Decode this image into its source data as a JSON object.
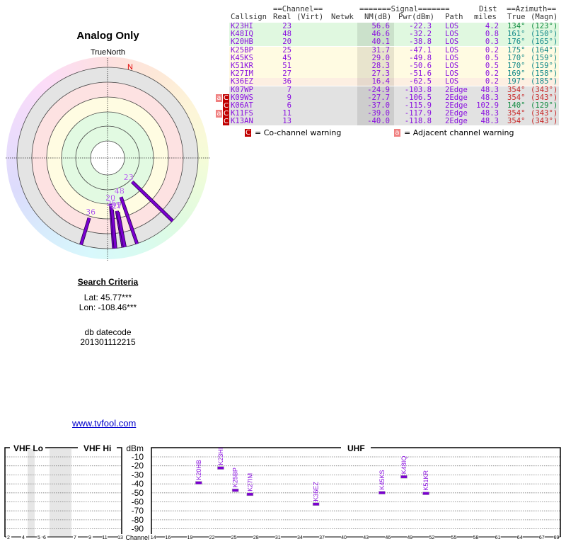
{
  "polar": {
    "title": "Analog Only",
    "north_label": "TrueNorth",
    "n_marker": "N"
  },
  "table": {
    "header1": {
      "channel": "==Channel==",
      "signal": "=======Signal=======",
      "dist": "Dist",
      "azimuth": "==Azimuth=="
    },
    "header2": {
      "callsign": "Callsign",
      "real": "Real",
      "virt": "(Virt)",
      "netwk": "Netwk",
      "nm": "NM(dB)",
      "pwr": "Pwr(dBm)",
      "path": "Path",
      "miles": "miles",
      "true": "True",
      "magn": "(Magn)"
    },
    "rows": [
      {
        "callsign": "K23HI",
        "real": "23",
        "nm": "56.6",
        "pwr": "-22.3",
        "path": "LOS",
        "dist": "4.2",
        "true": "134°",
        "magn": "(123°)",
        "band": "green",
        "az_color": "#108a40",
        "warn": "",
        "az": 134,
        "nmv": 56.6
      },
      {
        "callsign": "K48IQ",
        "real": "48",
        "nm": "46.6",
        "pwr": "-32.2",
        "path": "LOS",
        "dist": "0.8",
        "true": "161°",
        "magn": "(150°)",
        "band": "green",
        "az_color": "#108888",
        "warn": "",
        "az": 161,
        "nmv": 46.6
      },
      {
        "callsign": "K20HB",
        "real": "20",
        "nm": "40.1",
        "pwr": "-38.8",
        "path": "LOS",
        "dist": "0.3",
        "true": "176°",
        "magn": "(165°)",
        "band": "green",
        "az_color": "#108888",
        "warn": "",
        "az": 176,
        "nmv": 40.1
      },
      {
        "callsign": "K25BP",
        "real": "25",
        "nm": "31.7",
        "pwr": "-47.1",
        "path": "LOS",
        "dist": "0.2",
        "true": "175°",
        "magn": "(164°)",
        "band": "yellow",
        "az_color": "#108888",
        "warn": "",
        "az": 175,
        "nmv": 31.7
      },
      {
        "callsign": "K45KS",
        "real": "45",
        "nm": "29.0",
        "pwr": "-49.8",
        "path": "LOS",
        "dist": "0.5",
        "true": "170°",
        "magn": "(159°)",
        "band": "yellow",
        "az_color": "#108888",
        "warn": "",
        "az": 170,
        "nmv": 29.0
      },
      {
        "callsign": "K51KR",
        "real": "51",
        "nm": "28.3",
        "pwr": "-50.6",
        "path": "LOS",
        "dist": "0.5",
        "true": "170°",
        "magn": "(159°)",
        "band": "yellow",
        "az_color": "#108888",
        "warn": "",
        "az": 170,
        "nmv": 28.3
      },
      {
        "callsign": "K27IM",
        "real": "27",
        "nm": "27.3",
        "pwr": "-51.6",
        "path": "LOS",
        "dist": "0.2",
        "true": "169°",
        "magn": "(158°)",
        "band": "yellow",
        "az_color": "#108888",
        "warn": "",
        "az": 169,
        "nmv": 27.3
      },
      {
        "callsign": "K36EZ",
        "real": "36",
        "nm": "16.4",
        "pwr": "-62.5",
        "path": "LOS",
        "dist": "0.2",
        "true": "197°",
        "magn": "(185°)",
        "band": "peach",
        "az_color": "#108888",
        "warn": "",
        "az": 197,
        "nmv": 16.4
      },
      {
        "callsign": "K07WP",
        "real": "7",
        "nm": "-24.9",
        "pwr": "-103.8",
        "path": "2Edge",
        "dist": "48.3",
        "true": "354°",
        "magn": "(343°)",
        "band": "grey",
        "az_color": "#c82828",
        "warn": ""
      },
      {
        "callsign": "K09WS",
        "real": "9",
        "nm": "-27.7",
        "pwr": "-106.5",
        "path": "2Edge",
        "dist": "48.3",
        "true": "354°",
        "magn": "(343°)",
        "band": "grey",
        "az_color": "#c82828",
        "warn": "aC"
      },
      {
        "callsign": "K06AT",
        "real": "6",
        "nm": "-37.0",
        "pwr": "-115.9",
        "path": "2Edge",
        "dist": "102.9",
        "true": "140°",
        "magn": "(129°)",
        "band": "grey",
        "az_color": "#108a40",
        "warn": "C"
      },
      {
        "callsign": "K11FS",
        "real": "11",
        "nm": "-39.0",
        "pwr": "-117.9",
        "path": "2Edge",
        "dist": "48.3",
        "true": "354°",
        "magn": "(343°)",
        "band": "grey",
        "az_color": "#c82828",
        "warn": "aC"
      },
      {
        "callsign": "K13AN",
        "real": "13",
        "nm": "-40.0",
        "pwr": "-118.8",
        "path": "2Edge",
        "dist": "48.3",
        "true": "354°",
        "magn": "(343°)",
        "band": "grey",
        "az_color": "#c82828",
        "warn": "C"
      }
    ],
    "legend": {
      "co_badge": "C",
      "co_text": "= Co-channel warning",
      "adj_badge": "a",
      "adj_text": "= Adjacent channel warning"
    }
  },
  "colors": {
    "co_channel": "#c00000",
    "adjacent": "#f08080",
    "station": "#7a00d0",
    "green": "#e0f8e0",
    "yellow": "#fffbe2",
    "peach": "#fdefe2",
    "grey": "#e2e2e2"
  },
  "search": {
    "heading": "Search Criteria",
    "lat": "Lat: 45.77***",
    "lon": "Lon: -108.46***",
    "db_label": "db datecode",
    "db_value": "201301112215"
  },
  "link": "www.tvfool.com",
  "chart_data": {
    "type": "scatter",
    "panels": [
      "VHF Lo",
      "VHF Hi",
      "UHF"
    ],
    "ylabel": "dBm",
    "xlabel": "Channel",
    "yticks": [
      "-10",
      "-20",
      "-30",
      "-40",
      "-50",
      "-60",
      "-70",
      "-80",
      "-90"
    ],
    "ylim": [
      0,
      -100
    ],
    "vhf_ticks": [
      "2",
      "4",
      "5",
      "6",
      "7",
      "9",
      "11",
      "13"
    ],
    "uhf_ticks": [
      "14",
      "16",
      "19",
      "22",
      "25",
      "28",
      "31",
      "34",
      "37",
      "40",
      "43",
      "46",
      "49",
      "52",
      "55",
      "58",
      "61",
      "64",
      "67",
      "69"
    ],
    "grid": true,
    "points": [
      {
        "label": "K20HB",
        "channel": 20,
        "dbm": -38.8
      },
      {
        "label": "K23HI",
        "channel": 23,
        "dbm": -22.3
      },
      {
        "label": "K25BP",
        "channel": 25,
        "dbm": -47.1
      },
      {
        "label": "K27IM",
        "channel": 27,
        "dbm": -51.6
      },
      {
        "label": "K36EZ",
        "channel": 36,
        "dbm": -62.5
      },
      {
        "label": "K45KS",
        "channel": 45,
        "dbm": -49.8
      },
      {
        "label": "K48IQ",
        "channel": 48,
        "dbm": -32.2
      },
      {
        "label": "K51KR",
        "channel": 51,
        "dbm": -50.6
      }
    ]
  }
}
